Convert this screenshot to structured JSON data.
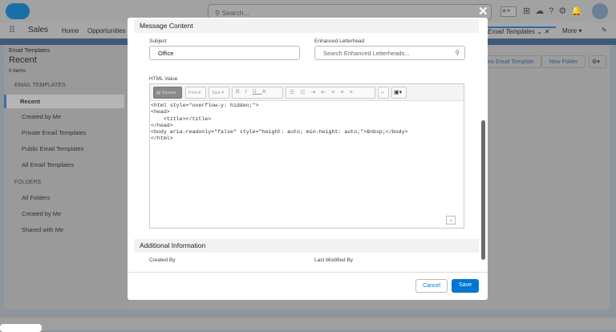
{
  "header": {
    "search_placeholder": "Search...",
    "avatar": "user-avatar"
  },
  "nav": {
    "app_name": "Sales",
    "items": [
      "Home",
      "Opportunities"
    ],
    "active_tab": "Email Templates",
    "more": "More"
  },
  "page": {
    "object": "Email Templates",
    "title": "Recent",
    "count": "0 items",
    "buttons": [
      "New Email Template",
      "New Folder"
    ]
  },
  "sidebar": {
    "section1": "EMAIL TEMPLATES",
    "items1": [
      "Recent",
      "Created by Me",
      "Private Email Templates",
      "Public Email Templates",
      "All Email Templates"
    ],
    "section2": "FOLDERS",
    "items2": [
      "All Folders",
      "Created by Me",
      "Shared with Me"
    ]
  },
  "modal": {
    "section_message": "Message Content",
    "subject_label": "Subject",
    "subject_value": "Office",
    "letterhead_label": "Enhanced Letterhead",
    "letterhead_placeholder": "Search Enhanced Letterheads...",
    "html_label": "HTML Value",
    "toolbar": {
      "source": "Source",
      "font": "Font",
      "size": "Size"
    },
    "html_code": "<html style=\"overflow-y: hidden;\">\n<head>\n    <title></title>\n</head>\n<body aria-readonly=\"false\" style=\"height: auto; min-height: auto;\">&nbsp;</body>\n</html>",
    "section_additional": "Additional Information",
    "created_by_label": "Created By",
    "last_modified_label": "Last Modified By",
    "cancel": "Cancel",
    "save": "Save"
  },
  "colors": {
    "brand": "#0176d3"
  }
}
